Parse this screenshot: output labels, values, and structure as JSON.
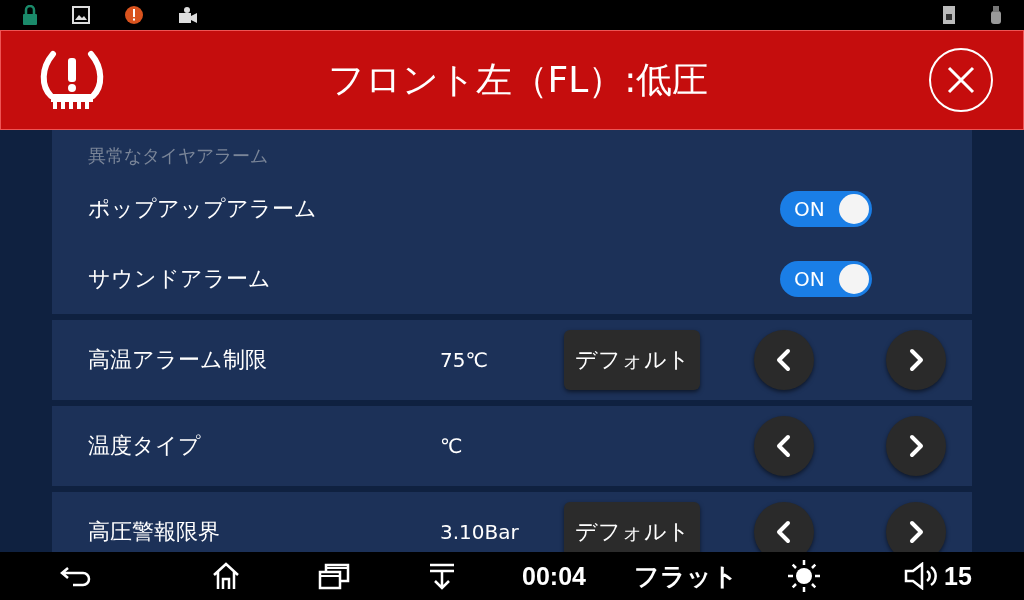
{
  "alert": {
    "title": "フロント左（FL）:低圧"
  },
  "section": {
    "title": "異常なタイヤアラーム",
    "toggles": [
      {
        "label": "ポップアップアラーム",
        "text": "ON",
        "on": true
      },
      {
        "label": "サウンドアラーム",
        "text": "ON",
        "on": true
      }
    ]
  },
  "settings": [
    {
      "label": "高温アラーム制限",
      "value": "75℃",
      "default_button": "デフォルト"
    },
    {
      "label": "温度タイプ",
      "value": "℃"
    },
    {
      "label": "高圧警報限界",
      "value": "3.10Bar",
      "default_button": "デフォルト"
    }
  ],
  "nav_bar": {
    "time": "00:04",
    "eq": "フラット",
    "volume": "15"
  }
}
